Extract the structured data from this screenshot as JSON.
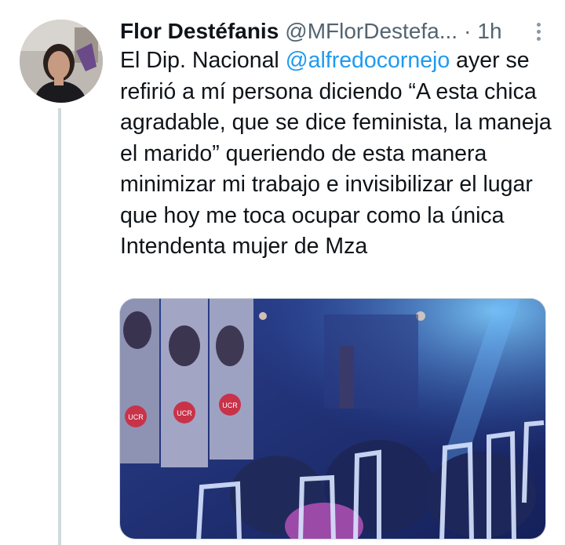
{
  "tweet": {
    "author_name": "Flor Destéfanis",
    "author_handle": "@MFlorDestefa...",
    "separator": "·",
    "time": "1h",
    "text_parts": {
      "intro": "El Dip. Nacional ",
      "mention": "@alfredocornejo",
      "body": " ayer se refirió a mí persona diciendo “A esta chica agradable, que se dice feminista, la maneja el marido” queriendo de esta manera minimizar  mi trabajo e invisibilizar el lugar que hoy me toca ocupar como la única Intendenta mujer de Mza"
    },
    "media": {
      "poster_text": [
        "UCR",
        "UCR",
        "UCR"
      ]
    }
  },
  "icons": {
    "more": "more-vertical-icon",
    "avatar": "profile-avatar"
  },
  "colors": {
    "mention": "#1d9bf0",
    "secondary_text": "#536471",
    "thread_line": "#cfd9de"
  }
}
